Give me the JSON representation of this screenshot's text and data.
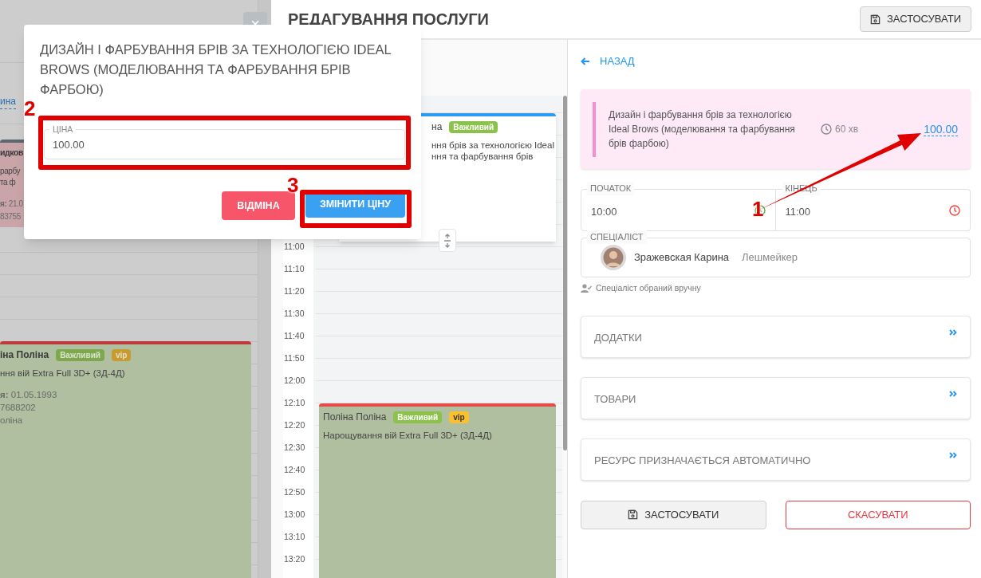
{
  "backdrop": {
    "close_button": "×",
    "link_fragment": "ина",
    "events": [
      {
        "kind": "pink",
        "color": "#5c6770",
        "name": "идков",
        "lines": [
          {
            "kind": "service",
            "text": "рарбу"
          },
          {
            "kind": "service",
            "text": "та ф"
          },
          {
            "kind": "info",
            "text": "**я:** 21.0"
          },
          {
            "kind": "info",
            "text": "83755"
          }
        ]
      },
      {
        "kind": "green",
        "color": "#c0393b",
        "name": "іна Поліна",
        "tags": [
          {
            "text": "Важливий",
            "color": "#7ea84e"
          },
          {
            "text": "vip",
            "color": "#c99a2e"
          }
        ],
        "lines": [
          {
            "kind": "service",
            "text": "ння вій Extra Full 3D+ (3Д-4Д)"
          },
          {
            "kind": "info",
            "text": "**я:** 01.05.1993"
          },
          {
            "kind": "info",
            "text": "7688202"
          },
          {
            "kind": "info",
            "text": "оліна"
          }
        ]
      }
    ]
  },
  "editor": {
    "title": "РЕДАГУВАННЯ ПОСЛУГИ",
    "header_button": "ЗАСТОСУВАТИ",
    "calendar": {
      "times": [
        "11:00",
        "11:10",
        "11:20",
        "11:30",
        "11:40",
        "11:50",
        "12:00",
        "12:10",
        "12:20",
        "12:30",
        "12:40",
        "12:50",
        "13:00",
        "13:10",
        "13:20"
      ],
      "events": [
        {
          "kind": "white",
          "color": "#2f9bf0",
          "name": "на",
          "tags": [
            {
              "text": "Важливий",
              "color": "#8bc34a"
            }
          ],
          "lines": [
            {
              "kind": "service",
              "text": "ння брів за технологією Ideal"
            },
            {
              "kind": "service",
              "text": "ння та фарбування брів"
            }
          ]
        },
        {
          "kind": "green",
          "color": "#e84a4a",
          "name": "Поліна Поліна",
          "tags": [
            {
              "text": "Важливий",
              "color": "#8bc34a"
            },
            {
              "text": "vip",
              "color": "#fbc02d"
            }
          ],
          "lines": [
            {
              "kind": "service",
              "text": "Нарощування вій Extra Full 3D+ (3Д-4Д)"
            }
          ]
        }
      ]
    },
    "back_link": "НАЗАД",
    "service": {
      "name": "Дизайн і фарбування брів за технологією Ideal Brows (моделювання та фарбування брів фарбою)",
      "duration": "60 хв",
      "price": "100.00"
    },
    "time_fields": [
      {
        "label": "ПОЧАТОК",
        "value": "10:00",
        "color": "#4caf50"
      },
      {
        "label": "КІНЕЦЬ",
        "value": "11:00",
        "color": "#f44336"
      }
    ],
    "specialist": {
      "label": "СПЕЦІАЛІСТ",
      "name": "Зражевская Карина",
      "role": "Лешмейкер"
    },
    "specialist_note": "Спеціаліст обраний вручну",
    "sections": [
      "ДОДАТКИ",
      "ТОВАРИ",
      "РЕСУРС ПРИЗНАЧАЄТЬСЯ АВТОМАТИЧНО"
    ],
    "buttons": [
      {
        "label": "ЗАСТОСУВАТИ",
        "kind": "apply"
      },
      {
        "label": "СКАСУВАТИ",
        "kind": "cancel"
      }
    ]
  },
  "dialog": {
    "title": "ДИЗАЙН І ФАРБУВАННЯ БРІВ ЗА ТЕХНОЛОГІЄЮ IDEAL BROWS (МОДЕЛЮВАННЯ ТА ФАРБУВАННЯ БРІВ ФАРБОЮ)",
    "field": {
      "label": "ЦІНА",
      "value": "100.00"
    },
    "buttons": [
      {
        "label": "ВІДМІНА",
        "kind": "cancel"
      },
      {
        "label": "ЗМІНИТИ ЦІНУ",
        "kind": "confirm"
      }
    ]
  },
  "annotations": [
    "1",
    "2",
    "3"
  ]
}
